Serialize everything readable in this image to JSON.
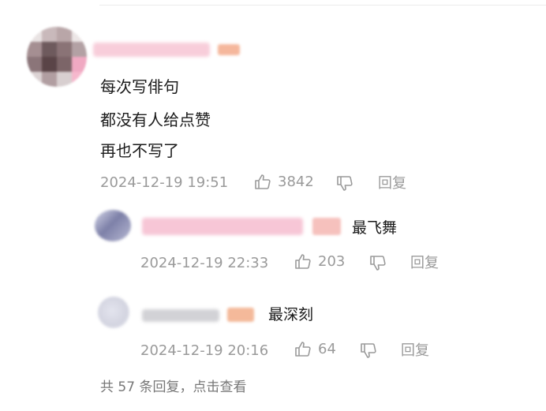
{
  "comment": {
    "lines": [
      "每次写俳句",
      "都没有人给点赞",
      "再也不写了"
    ],
    "timestamp": "2024-12-19 19:51",
    "like_count": "3842",
    "reply_label": "回复"
  },
  "replies": [
    {
      "username": "最飞舞",
      "timestamp": "2024-12-19 22:33",
      "like_count": "203",
      "reply_label": "回复"
    },
    {
      "username": "最深刻",
      "timestamp": "2024-12-19 20:16",
      "like_count": "64",
      "reply_label": "回复"
    }
  ],
  "footer": {
    "more_replies": "共 57 条回复，点击查看"
  },
  "colors": {
    "meta_gray": "#9a9a9a",
    "text_dark": "#1a1a1a",
    "blur_pink": "#f7c6d6",
    "blur_orange": "#f4b99a"
  },
  "icons": [
    "thumbs-up-icon",
    "thumbs-down-icon"
  ]
}
